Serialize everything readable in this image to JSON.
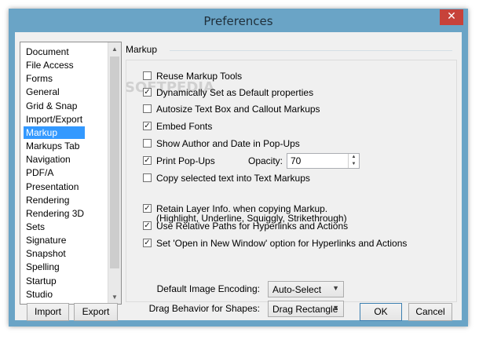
{
  "window": {
    "title": "Preferences",
    "close_glyph": "✕"
  },
  "sidebar": {
    "items": [
      {
        "label": "Document"
      },
      {
        "label": "File Access"
      },
      {
        "label": "Forms"
      },
      {
        "label": "General"
      },
      {
        "label": "Grid & Snap"
      },
      {
        "label": "Import/Export"
      },
      {
        "label": "Markup",
        "selected": true
      },
      {
        "label": "Markups Tab"
      },
      {
        "label": "Navigation"
      },
      {
        "label": "PDF/A"
      },
      {
        "label": "Presentation"
      },
      {
        "label": "Rendering"
      },
      {
        "label": "Rendering 3D"
      },
      {
        "label": "Sets"
      },
      {
        "label": "Signature"
      },
      {
        "label": "Snapshot"
      },
      {
        "label": "Spelling"
      },
      {
        "label": "Startup"
      },
      {
        "label": "Studio"
      }
    ],
    "scroll_up": "▲",
    "scroll_down": "▼"
  },
  "panel": {
    "title": "Markup",
    "options": [
      {
        "label": "Reuse Markup Tools",
        "checked": false
      },
      {
        "label": "Dynamically Set as Default properties",
        "checked": true
      },
      {
        "label": "Autosize Text Box and Callout Markups",
        "checked": false
      },
      {
        "label": "Embed Fonts",
        "checked": true
      },
      {
        "label": "Show Author and Date in Pop-Ups",
        "checked": false
      },
      {
        "label": "Print Pop-Ups",
        "checked": true
      },
      {
        "label": "Copy selected text into Text Markups",
        "checked": false
      },
      {
        "label": "Retain Layer Info. when copying Markup.",
        "checked": true
      },
      {
        "label": "Use Relative Paths for Hyperlinks and Actions",
        "checked": true
      },
      {
        "label": "Set 'Open in New Window' option for Hyperlinks and Actions",
        "checked": true
      }
    ],
    "copy_text_sublabel": "(Highlight, Underline, Squiggly, Strikethrough)",
    "opacity": {
      "label": "Opacity:",
      "value": "70",
      "spin_up": "▲",
      "spin_down": "▼"
    },
    "image_encoding": {
      "label": "Default Image Encoding:",
      "value": "Auto-Select"
    },
    "drag_behavior": {
      "label": "Drag Behavior for Shapes:",
      "value": "Drag Rectangle"
    },
    "dropdown_arrow": "▼"
  },
  "footer": {
    "import": "Import",
    "export": "Export",
    "ok": "OK",
    "cancel": "Cancel"
  },
  "watermark": "SOFTPEDIA",
  "check_mark": "✓"
}
